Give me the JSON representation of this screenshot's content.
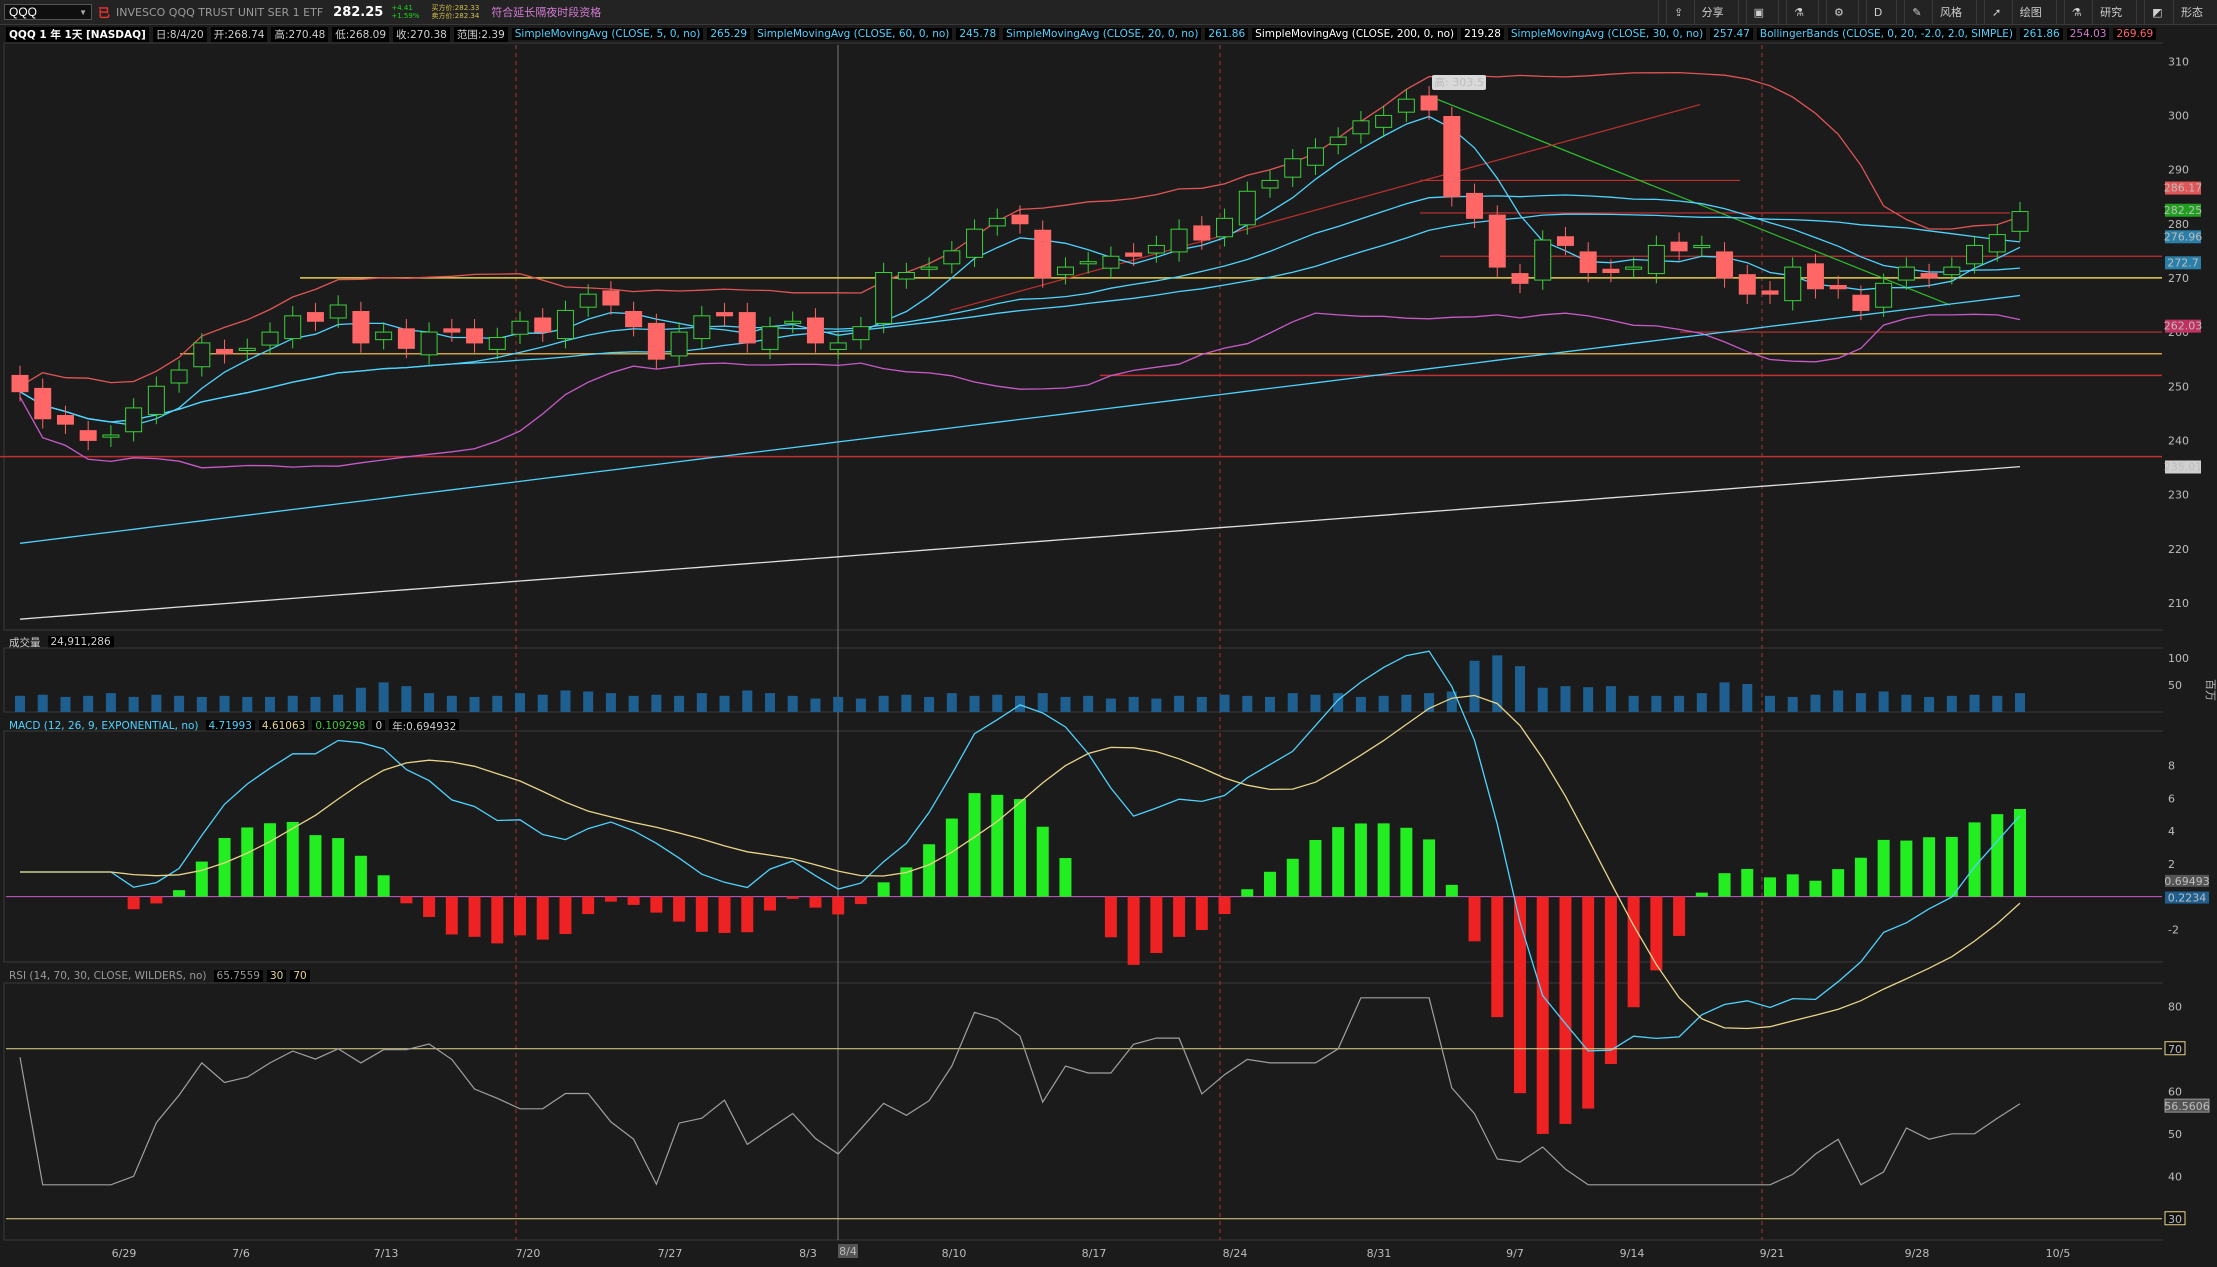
{
  "toolbar": {
    "symbol": "QQQ",
    "flag": "已",
    "description": "INVESCO QQQ TRUST UNIT SER 1 ETF",
    "last": "282.25",
    "change": "+4.41",
    "change_pct": "+1.59%",
    "bid": "买方价:282.33",
    "ask": "卖方价:282.34",
    "extended": "符合延长隔夜时段资格",
    "right": [
      "分享",
      "D",
      "风格",
      "绘图",
      "研究",
      "形态"
    ],
    "icons": [
      "share-icon",
      "camera-icon",
      "flask-icon",
      "gear-icon",
      "brush-icon",
      "cursor-icon",
      "pencil-icon",
      "flask-icon",
      "shapes-icon"
    ]
  },
  "studybar": {
    "title": "QQQ 1 年 1天 [NASDAQ]",
    "ohlc": [
      "日:8/4/20",
      "开:268.74",
      "高:270.48",
      "低:268.09",
      "收:270.38",
      "范围:2.39"
    ],
    "studies": [
      {
        "name": "SimpleMovingAvg (CLOSE, 5, 0, no)",
        "value": "265.29",
        "color": "#4fd3ff"
      },
      {
        "name": "SimpleMovingAvg (CLOSE, 60, 0, no)",
        "value": "245.78",
        "color": "#4fd3ff"
      },
      {
        "name": "SimpleMovingAvg (CLOSE, 20, 0, no)",
        "value": "261.86",
        "color": "#4fd3ff"
      },
      {
        "name": "SimpleMovingAvg (CLOSE, 200, 0, no)",
        "value": "219.28",
        "color": "#ffffff"
      },
      {
        "name": "SimpleMovingAvg (CLOSE, 30, 0, no)",
        "value": "257.47",
        "color": "#4fd3ff"
      },
      {
        "name": "BollingerBands (CLOSE, 0, 20, -2.0, 2.0, SIMPLE)",
        "value": "261.86",
        "color": "#4fd3ff"
      }
    ],
    "bb_lower": "254.03",
    "bb_upper": "269.69"
  },
  "volume_label": {
    "name": "成交量",
    "value": "24,911,286"
  },
  "macd_label": {
    "name": "MACD (12, 26, 9, EXPONENTIAL, no)",
    "value": "4.71993",
    "avg": "4.61063",
    "diff": "0.109298",
    "zero": "0",
    "extra": "年:0.694932"
  },
  "rsi_label": {
    "name": "RSI (14, 70, 30, CLOSE, WILDERS, no)",
    "value": "65.7559",
    "os": "30",
    "ob": "70"
  },
  "annotations": {
    "high": "高: 303.5",
    "cursor_date": "8/4",
    "vol_axis": "百万"
  },
  "colors": {
    "up": "#3bd13b",
    "down": "#ff6666",
    "sma": "#4fd3ff",
    "bb": "#e05555",
    "bb_mid": "#c85ac8",
    "sma200": "#e0e0e0"
  },
  "chart_data": {
    "type": "candlestick",
    "x_ticks": [
      "6/29",
      "7/6",
      "7/13",
      "7/20",
      "7/27",
      "8/3",
      "8/10",
      "8/17",
      "8/24",
      "8/31",
      "9/7",
      "9/14",
      "9/21",
      "9/28",
      "10/5"
    ],
    "price_ticks": [
      210,
      220,
      230,
      240,
      250,
      260,
      270,
      280,
      290,
      300,
      310
    ],
    "price_tags": [
      {
        "value": "286.17",
        "color": "#e05555"
      },
      {
        "value": "282.25",
        "color": "#1fa01f"
      },
      {
        "value": "276.96",
        "color": "#2a7fa8"
      },
      {
        "value": "272.7",
        "color": "#2a7fa8"
      },
      {
        "value": "262.03",
        "color": "#c03060"
      },
      {
        "value": "235.01",
        "color": "#d0d0d0"
      }
    ],
    "closes": [
      249,
      244,
      243,
      240,
      241,
      246,
      250,
      253,
      258,
      256,
      257,
      260,
      263,
      262,
      265,
      258,
      260,
      257,
      260,
      260,
      258,
      259,
      262,
      260,
      264,
      267,
      265,
      261,
      255,
      260,
      263,
      263,
      258,
      261,
      262,
      258,
      258,
      261,
      271,
      271,
      272,
      275,
      279,
      281,
      280,
      270,
      272,
      273,
      274,
      274,
      276,
      279,
      277,
      281,
      286,
      288,
      292,
      294,
      296,
      299,
      300,
      303,
      301,
      285,
      281,
      272,
      269,
      277,
      276,
      271,
      271,
      272,
      276,
      275,
      276,
      270,
      267,
      267,
      272,
      268,
      268,
      264,
      269,
      272,
      270,
      272,
      276,
      278,
      282.25
    ],
    "volume_ticks": [
      50,
      100
    ],
    "volumes": [
      30,
      32,
      28,
      30,
      35,
      28,
      32,
      30,
      28,
      30,
      28,
      28,
      30,
      28,
      32,
      45,
      55,
      48,
      35,
      30,
      28,
      30,
      35,
      32,
      40,
      38,
      35,
      30,
      32,
      30,
      35,
      30,
      40,
      35,
      30,
      25,
      28,
      25,
      30,
      32,
      28,
      35,
      30,
      32,
      30,
      35,
      28,
      30,
      25,
      28,
      25,
      30,
      28,
      32,
      30,
      28,
      35,
      32,
      35,
      28,
      30,
      32,
      35,
      38,
      95,
      105,
      85,
      45,
      48,
      46,
      48,
      30,
      30,
      30,
      35,
      55,
      52,
      30,
      28,
      32,
      40,
      35,
      38,
      32,
      28,
      30,
      32,
      30,
      35
    ],
    "macd_ticks": [
      -2,
      2,
      4,
      6,
      8
    ],
    "macd_tags": [
      "0.69493",
      "0.2234"
    ],
    "rsi_ticks": [
      40,
      50,
      60,
      80
    ],
    "rsi_tags": [
      {
        "value": "70",
        "color": "#e8d48a"
      },
      {
        "value": "56.5606",
        "color": "#9a9a9a"
      },
      {
        "value": "30",
        "color": "#e8d48a"
      }
    ]
  }
}
